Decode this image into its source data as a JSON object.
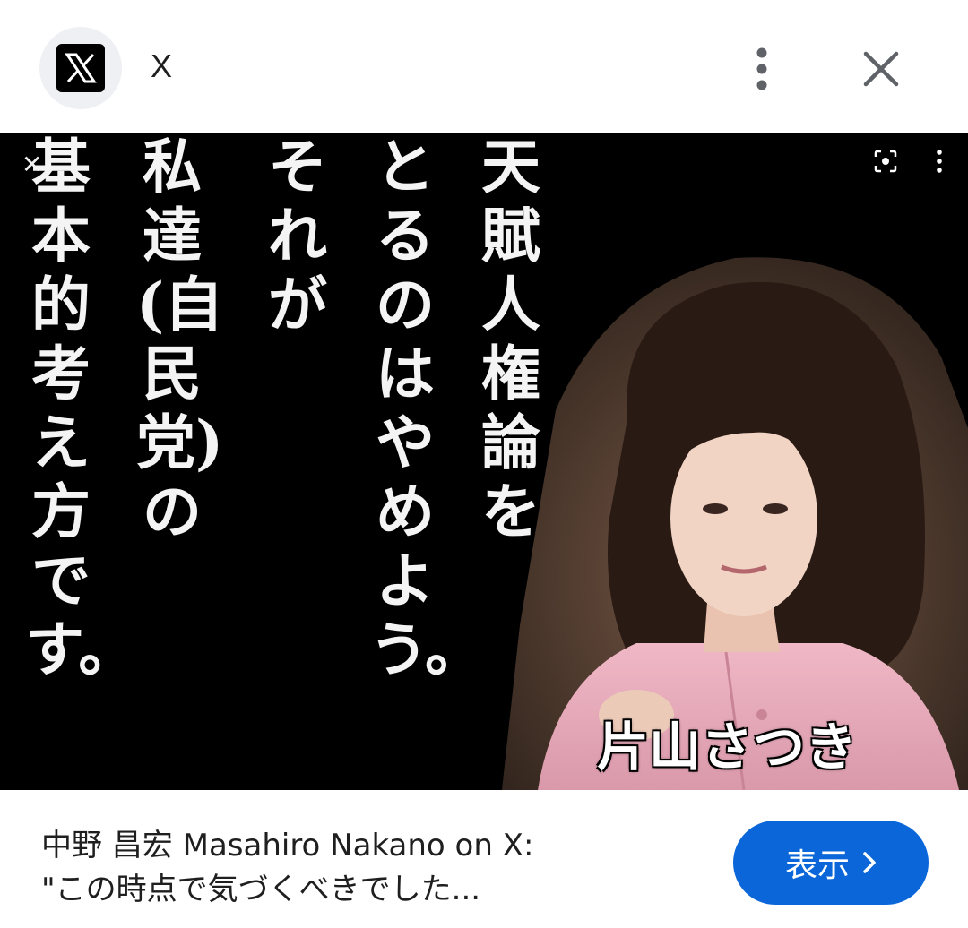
{
  "header": {
    "site_name": "X",
    "logo_letter": "X",
    "menu_icon": "more-vert-icon",
    "close_icon": "close-icon"
  },
  "image": {
    "quote_columns": [
      "天賦人権論を",
      "とるのはやめよう。",
      "それが",
      "私達(自民党)の",
      "基本的考え方です。"
    ],
    "caption_name": "片山さつき",
    "lens_icon": "lens-icon",
    "more_icon": "more-vert-icon",
    "corner_icon": "close-icon"
  },
  "result": {
    "title_line1": "中野 昌宏 Masahiro Nakano on X:",
    "title_line2": "\"この時点で気づくべきでした...",
    "visit_label": "表示",
    "visit_icon": "chevron-right-icon"
  },
  "colors": {
    "accent": "#0b67d9",
    "panel_bg": "#000000",
    "jacket": "#e8a9b8"
  }
}
